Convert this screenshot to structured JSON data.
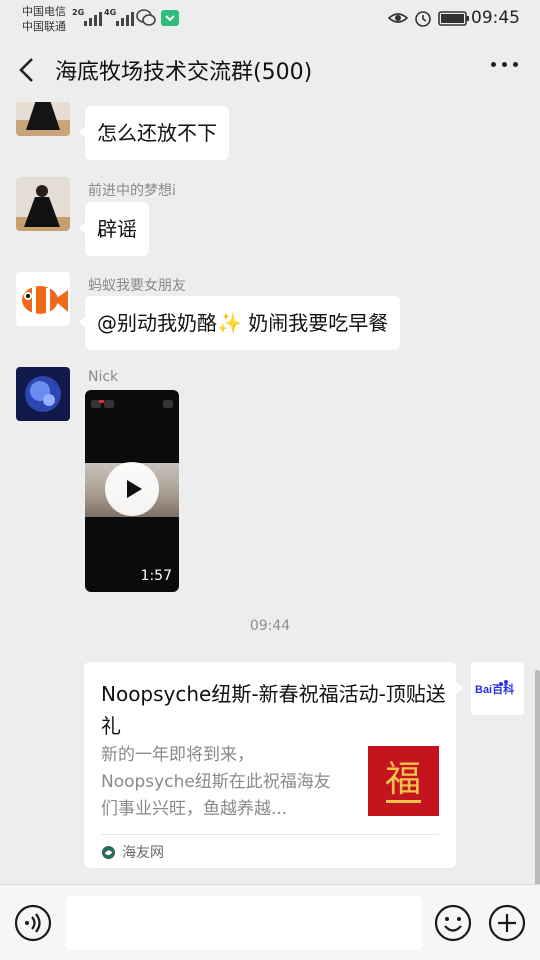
{
  "status_bar": {
    "carrier_1": "中国电信",
    "carrier_2": "中国联通",
    "net_1": "2G",
    "net_2": "4G",
    "time": "09:45"
  },
  "header": {
    "title": "海底牧场技术交流群(500)"
  },
  "messages": [
    {
      "sender": "",
      "text": "怎么还放不下"
    },
    {
      "sender": "前进中的梦想i",
      "text": "辟谣"
    },
    {
      "sender": "蚂蚁我要女朋友",
      "text": "@别动我奶酪✨ 奶闹我要吃早餐"
    },
    {
      "sender": "Nick",
      "video_duration": "1:57"
    }
  ],
  "timestamp": "09:44",
  "link_card": {
    "title": "Noopsyche纽斯-新春祝福活动-顶贴送礼",
    "description": "新的一年即将到来，Noopsyche纽斯在此祝福海友们事业兴旺，鱼越养越...",
    "source": "海友网",
    "thumb_char": "福",
    "sender_avatar_text": "Bai百科"
  },
  "colors": {
    "background": "#ededed",
    "bubble": "#ffffff",
    "thumb_red": "#c4141e",
    "baidu_blue": "#2932e1",
    "baidu_red": "#de0b0b"
  },
  "icons": {
    "back": "chevron-left-icon",
    "more": "more-dots-icon",
    "voice": "voice-icon",
    "emoji": "emoji-icon",
    "plus": "plus-icon",
    "play": "play-icon"
  }
}
